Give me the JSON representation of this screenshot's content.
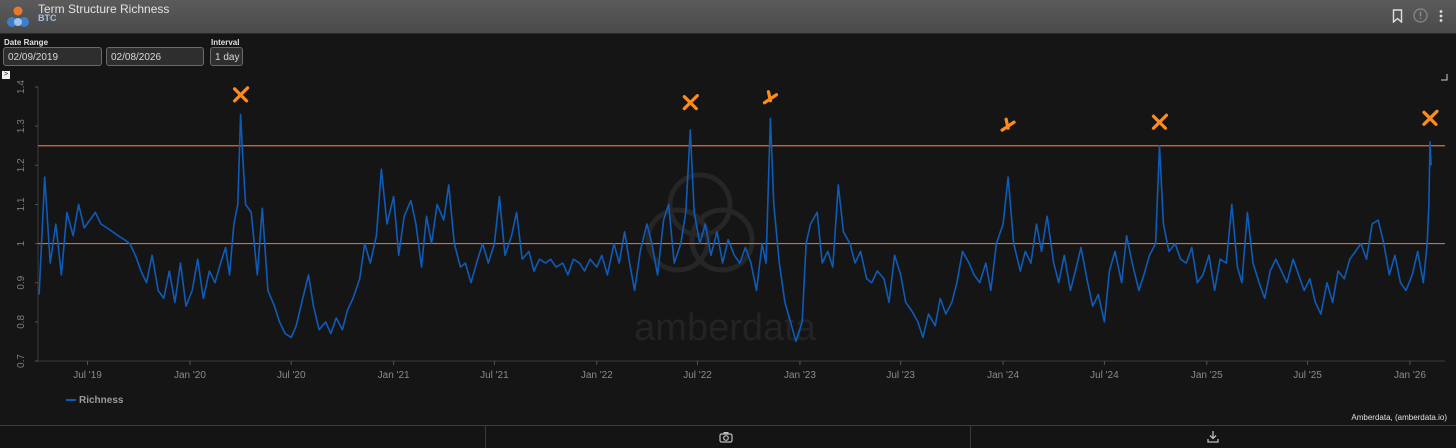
{
  "header": {
    "title": "Term Structure Richness",
    "subtitle": "BTC",
    "bookmark_icon": "bookmark-icon",
    "info_icon": "info-icon",
    "menu_icon": "more-vertical-icon"
  },
  "controls": {
    "date_range_label": "Date Range",
    "start_date": "02/09/2019",
    "end_date": "02/08/2026",
    "interval_label": "Interval",
    "interval_value": "1 day"
  },
  "legend": {
    "series_label": "Richness"
  },
  "credit": "Amberdata, (amberdata.io)",
  "watermark": "amberdata",
  "footer": {
    "camera_icon": "camera-icon",
    "download_icon": "download-icon"
  },
  "colors": {
    "series": "#0f5bb8",
    "reference_lines": "#e2683c",
    "annotations": "#ff8c1a",
    "background": "#151515"
  },
  "chart_data": {
    "type": "line",
    "y_ticks": [
      "0.7",
      "0.8",
      "0.9",
      "1",
      "1.1",
      "1.2",
      "1.3",
      "1.4"
    ],
    "ylim": [
      0.7,
      1.4
    ],
    "x_ticks": [
      "Jul '19",
      "Jan '20",
      "Jul '20",
      "Jan '21",
      "Jul '21",
      "Jan '22",
      "Jul '22",
      "Jan '23",
      "Jul '23",
      "Jan '24",
      "Jul '24",
      "Jan '25",
      "Jul '25",
      "Jan '26"
    ],
    "x_tick_dates": [
      "2019-07-01",
      "2020-01-01",
      "2020-07-01",
      "2021-01-01",
      "2021-07-01",
      "2022-01-01",
      "2022-07-01",
      "2023-01-01",
      "2023-07-01",
      "2024-01-01",
      "2024-07-01",
      "2025-01-01",
      "2025-07-01",
      "2026-01-01"
    ],
    "xlim": [
      "2019-04-03",
      "2026-03-05"
    ],
    "reference_lines": [
      1.0,
      1.25
    ],
    "series": [
      {
        "name": "Richness",
        "points": [
          [
            "2019-04-05",
            0.87
          ],
          [
            "2019-04-15",
            1.17
          ],
          [
            "2019-04-25",
            0.95
          ],
          [
            "2019-05-05",
            1.05
          ],
          [
            "2019-05-15",
            0.92
          ],
          [
            "2019-05-25",
            1.08
          ],
          [
            "2019-06-05",
            1.02
          ],
          [
            "2019-06-15",
            1.1
          ],
          [
            "2019-06-25",
            1.04
          ],
          [
            "2019-07-05",
            1.06
          ],
          [
            "2019-07-15",
            1.08
          ],
          [
            "2019-07-25",
            1.05
          ],
          [
            "2019-08-05",
            1.04
          ],
          [
            "2019-08-15",
            1.03
          ],
          [
            "2019-08-25",
            1.02
          ],
          [
            "2019-09-05",
            1.01
          ],
          [
            "2019-09-15",
            1.0
          ],
          [
            "2019-09-25",
            0.97
          ],
          [
            "2019-10-05",
            0.93
          ],
          [
            "2019-10-15",
            0.9
          ],
          [
            "2019-10-25",
            0.97
          ],
          [
            "2019-11-05",
            0.88
          ],
          [
            "2019-11-15",
            0.86
          ],
          [
            "2019-11-25",
            0.93
          ],
          [
            "2019-12-05",
            0.85
          ],
          [
            "2019-12-15",
            0.95
          ],
          [
            "2019-12-25",
            0.84
          ],
          [
            "2020-01-05",
            0.88
          ],
          [
            "2020-01-15",
            0.96
          ],
          [
            "2020-01-25",
            0.86
          ],
          [
            "2020-02-05",
            0.93
          ],
          [
            "2020-02-15",
            0.9
          ],
          [
            "2020-02-25",
            0.95
          ],
          [
            "2020-03-05",
            0.99
          ],
          [
            "2020-03-12",
            0.92
          ],
          [
            "2020-03-20",
            1.05
          ],
          [
            "2020-03-27",
            1.1
          ],
          [
            "2020-04-01",
            1.33
          ],
          [
            "2020-04-05",
            1.22
          ],
          [
            "2020-04-10",
            1.1
          ],
          [
            "2020-04-20",
            1.08
          ],
          [
            "2020-05-01",
            0.92
          ],
          [
            "2020-05-10",
            1.09
          ],
          [
            "2020-05-20",
            0.88
          ],
          [
            "2020-06-01",
            0.84
          ],
          [
            "2020-06-10",
            0.8
          ],
          [
            "2020-06-20",
            0.77
          ],
          [
            "2020-07-01",
            0.76
          ],
          [
            "2020-07-10",
            0.79
          ],
          [
            "2020-07-20",
            0.85
          ],
          [
            "2020-08-01",
            0.92
          ],
          [
            "2020-08-10",
            0.84
          ],
          [
            "2020-08-20",
            0.78
          ],
          [
            "2020-09-01",
            0.8
          ],
          [
            "2020-09-10",
            0.77
          ],
          [
            "2020-09-20",
            0.81
          ],
          [
            "2020-10-01",
            0.78
          ],
          [
            "2020-10-10",
            0.83
          ],
          [
            "2020-10-20",
            0.86
          ],
          [
            "2020-11-01",
            0.91
          ],
          [
            "2020-11-10",
            1.0
          ],
          [
            "2020-11-20",
            0.95
          ],
          [
            "2020-12-01",
            1.02
          ],
          [
            "2020-12-10",
            1.19
          ],
          [
            "2020-12-20",
            1.05
          ],
          [
            "2021-01-01",
            1.12
          ],
          [
            "2021-01-10",
            0.97
          ],
          [
            "2021-01-20",
            1.07
          ],
          [
            "2021-02-01",
            1.11
          ],
          [
            "2021-02-10",
            1.05
          ],
          [
            "2021-02-20",
            0.94
          ],
          [
            "2021-03-01",
            1.07
          ],
          [
            "2021-03-10",
            1.0
          ],
          [
            "2021-03-20",
            1.1
          ],
          [
            "2021-04-01",
            1.06
          ],
          [
            "2021-04-10",
            1.15
          ],
          [
            "2021-04-20",
            1.0
          ],
          [
            "2021-05-01",
            0.94
          ],
          [
            "2021-05-10",
            0.95
          ],
          [
            "2021-05-20",
            0.9
          ],
          [
            "2021-06-01",
            0.96
          ],
          [
            "2021-06-10",
            1.0
          ],
          [
            "2021-06-20",
            0.95
          ],
          [
            "2021-07-01",
            1.0
          ],
          [
            "2021-07-10",
            1.12
          ],
          [
            "2021-07-20",
            0.97
          ],
          [
            "2021-08-01",
            1.02
          ],
          [
            "2021-08-10",
            1.08
          ],
          [
            "2021-08-20",
            0.96
          ],
          [
            "2021-09-01",
            0.98
          ],
          [
            "2021-09-10",
            0.93
          ],
          [
            "2021-09-20",
            0.96
          ],
          [
            "2021-10-01",
            0.95
          ],
          [
            "2021-10-10",
            0.96
          ],
          [
            "2021-10-20",
            0.94
          ],
          [
            "2021-11-01",
            0.95
          ],
          [
            "2021-11-10",
            0.92
          ],
          [
            "2021-11-20",
            0.96
          ],
          [
            "2021-12-01",
            0.95
          ],
          [
            "2021-12-10",
            0.93
          ],
          [
            "2021-12-20",
            0.96
          ],
          [
            "2022-01-01",
            0.94
          ],
          [
            "2022-01-10",
            0.97
          ],
          [
            "2022-01-20",
            0.92
          ],
          [
            "2022-02-01",
            1.0
          ],
          [
            "2022-02-10",
            0.95
          ],
          [
            "2022-02-20",
            1.03
          ],
          [
            "2022-03-01",
            0.95
          ],
          [
            "2022-03-10",
            0.88
          ],
          [
            "2022-03-20",
            0.98
          ],
          [
            "2022-04-01",
            1.05
          ],
          [
            "2022-04-10",
            1.0
          ],
          [
            "2022-04-20",
            0.92
          ],
          [
            "2022-05-01",
            1.06
          ],
          [
            "2022-05-10",
            1.1
          ],
          [
            "2022-05-20",
            0.95
          ],
          [
            "2022-06-01",
            1.0
          ],
          [
            "2022-06-10",
            1.08
          ],
          [
            "2022-06-18",
            1.29
          ],
          [
            "2022-06-25",
            1.08
          ],
          [
            "2022-07-05",
            1.0
          ],
          [
            "2022-07-15",
            1.05
          ],
          [
            "2022-07-25",
            0.97
          ],
          [
            "2022-08-05",
            1.03
          ],
          [
            "2022-08-15",
            0.95
          ],
          [
            "2022-08-25",
            1.01
          ],
          [
            "2022-09-05",
            0.97
          ],
          [
            "2022-09-15",
            0.95
          ],
          [
            "2022-09-25",
            0.99
          ],
          [
            "2022-10-05",
            0.95
          ],
          [
            "2022-10-15",
            0.88
          ],
          [
            "2022-10-25",
            1.0
          ],
          [
            "2022-11-01",
            0.95
          ],
          [
            "2022-11-09",
            1.32
          ],
          [
            "2022-11-15",
            1.1
          ],
          [
            "2022-11-25",
            0.95
          ],
          [
            "2022-12-05",
            0.85
          ],
          [
            "2022-12-15",
            0.8
          ],
          [
            "2022-12-25",
            0.75
          ],
          [
            "2023-01-05",
            0.8
          ],
          [
            "2023-01-12",
            1.0
          ],
          [
            "2023-01-20",
            1.05
          ],
          [
            "2023-02-01",
            1.08
          ],
          [
            "2023-02-10",
            0.95
          ],
          [
            "2023-02-20",
            0.98
          ],
          [
            "2023-03-01",
            0.94
          ],
          [
            "2023-03-11",
            1.15
          ],
          [
            "2023-03-20",
            1.03
          ],
          [
            "2023-04-01",
            1.0
          ],
          [
            "2023-04-10",
            0.95
          ],
          [
            "2023-04-20",
            0.98
          ],
          [
            "2023-05-01",
            0.91
          ],
          [
            "2023-05-10",
            0.9
          ],
          [
            "2023-05-20",
            0.93
          ],
          [
            "2023-06-01",
            0.91
          ],
          [
            "2023-06-10",
            0.85
          ],
          [
            "2023-06-20",
            0.97
          ],
          [
            "2023-07-01",
            0.92
          ],
          [
            "2023-07-10",
            0.85
          ],
          [
            "2023-07-20",
            0.83
          ],
          [
            "2023-08-01",
            0.8
          ],
          [
            "2023-08-10",
            0.76
          ],
          [
            "2023-08-20",
            0.82
          ],
          [
            "2023-09-01",
            0.79
          ],
          [
            "2023-09-10",
            0.86
          ],
          [
            "2023-09-20",
            0.82
          ],
          [
            "2023-10-01",
            0.85
          ],
          [
            "2023-10-10",
            0.9
          ],
          [
            "2023-10-20",
            0.98
          ],
          [
            "2023-11-01",
            0.95
          ],
          [
            "2023-11-10",
            0.92
          ],
          [
            "2023-11-20",
            0.9
          ],
          [
            "2023-12-01",
            0.95
          ],
          [
            "2023-12-10",
            0.88
          ],
          [
            "2023-12-20",
            1.0
          ],
          [
            "2024-01-01",
            1.05
          ],
          [
            "2024-01-10",
            1.17
          ],
          [
            "2024-01-20",
            1.0
          ],
          [
            "2024-02-01",
            0.93
          ],
          [
            "2024-02-10",
            0.98
          ],
          [
            "2024-02-20",
            0.95
          ],
          [
            "2024-03-01",
            1.05
          ],
          [
            "2024-03-10",
            0.98
          ],
          [
            "2024-03-20",
            1.07
          ],
          [
            "2024-04-01",
            0.95
          ],
          [
            "2024-04-10",
            0.9
          ],
          [
            "2024-04-20",
            0.97
          ],
          [
            "2024-05-01",
            0.88
          ],
          [
            "2024-05-10",
            0.93
          ],
          [
            "2024-05-20",
            0.99
          ],
          [
            "2024-06-01",
            0.9
          ],
          [
            "2024-06-10",
            0.84
          ],
          [
            "2024-06-20",
            0.87
          ],
          [
            "2024-07-01",
            0.8
          ],
          [
            "2024-07-10",
            0.93
          ],
          [
            "2024-07-20",
            0.98
          ],
          [
            "2024-08-01",
            0.9
          ],
          [
            "2024-08-10",
            1.02
          ],
          [
            "2024-08-20",
            0.95
          ],
          [
            "2024-09-01",
            0.88
          ],
          [
            "2024-09-10",
            0.92
          ],
          [
            "2024-09-20",
            0.97
          ],
          [
            "2024-10-01",
            1.0
          ],
          [
            "2024-10-08",
            1.25
          ],
          [
            "2024-10-15",
            1.05
          ],
          [
            "2024-10-25",
            0.98
          ],
          [
            "2024-11-05",
            1.0
          ],
          [
            "2024-11-15",
            0.96
          ],
          [
            "2024-11-25",
            0.95
          ],
          [
            "2024-12-05",
            0.99
          ],
          [
            "2024-12-15",
            0.9
          ],
          [
            "2024-12-25",
            0.92
          ],
          [
            "2025-01-05",
            0.97
          ],
          [
            "2025-01-15",
            0.88
          ],
          [
            "2025-01-25",
            0.96
          ],
          [
            "2025-02-05",
            0.95
          ],
          [
            "2025-02-15",
            1.1
          ],
          [
            "2025-02-25",
            0.94
          ],
          [
            "2025-03-05",
            0.9
          ],
          [
            "2025-03-15",
            1.08
          ],
          [
            "2025-03-25",
            0.95
          ],
          [
            "2025-04-05",
            0.9
          ],
          [
            "2025-04-15",
            0.86
          ],
          [
            "2025-04-25",
            0.93
          ],
          [
            "2025-05-05",
            0.96
          ],
          [
            "2025-05-15",
            0.93
          ],
          [
            "2025-05-25",
            0.9
          ],
          [
            "2025-06-05",
            0.96
          ],
          [
            "2025-06-15",
            0.92
          ],
          [
            "2025-06-25",
            0.88
          ],
          [
            "2025-07-05",
            0.91
          ],
          [
            "2025-07-15",
            0.85
          ],
          [
            "2025-07-25",
            0.82
          ],
          [
            "2025-08-05",
            0.9
          ],
          [
            "2025-08-15",
            0.85
          ],
          [
            "2025-08-25",
            0.93
          ],
          [
            "2025-09-05",
            0.91
          ],
          [
            "2025-09-15",
            0.96
          ],
          [
            "2025-09-25",
            0.98
          ],
          [
            "2025-10-05",
            1.0
          ],
          [
            "2025-10-15",
            0.96
          ],
          [
            "2025-10-25",
            1.05
          ],
          [
            "2025-11-05",
            1.06
          ],
          [
            "2025-11-15",
            1.0
          ],
          [
            "2025-11-25",
            0.92
          ],
          [
            "2025-12-05",
            0.97
          ],
          [
            "2025-12-15",
            0.9
          ],
          [
            "2025-12-25",
            0.88
          ],
          [
            "2026-01-05",
            0.92
          ],
          [
            "2026-01-15",
            0.98
          ],
          [
            "2026-01-25",
            0.9
          ],
          [
            "2026-02-01",
            1.0
          ],
          [
            "2026-02-04",
            1.1
          ],
          [
            "2026-02-06",
            1.26
          ],
          [
            "2026-02-08",
            1.2
          ]
        ]
      }
    ],
    "annotations": [
      {
        "shape": "x",
        "date": "2020-04-01",
        "value": 1.38
      },
      {
        "shape": "x",
        "date": "2022-06-18",
        "value": 1.36
      },
      {
        "shape": "check",
        "date": "2022-11-09",
        "value": 1.37
      },
      {
        "shape": "check",
        "date": "2024-01-10",
        "value": 1.3
      },
      {
        "shape": "x",
        "date": "2024-10-08",
        "value": 1.31
      },
      {
        "shape": "x",
        "date": "2026-02-06",
        "value": 1.32
      }
    ]
  }
}
